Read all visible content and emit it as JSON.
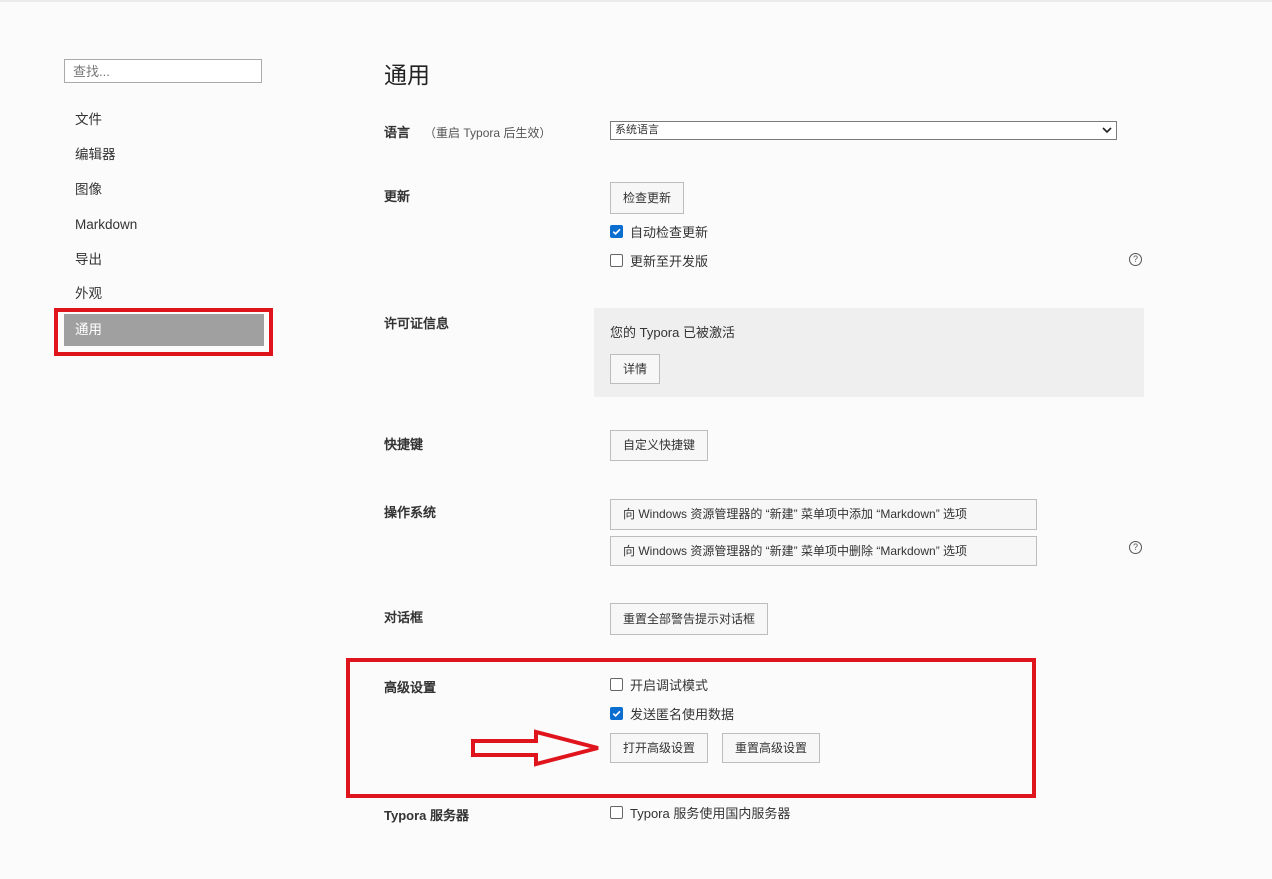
{
  "sidebar": {
    "search_placeholder": "查找...",
    "items": [
      {
        "label": "文件"
      },
      {
        "label": "编辑器"
      },
      {
        "label": "图像"
      },
      {
        "label": "Markdown"
      },
      {
        "label": "导出"
      },
      {
        "label": "外观"
      },
      {
        "label": "通用",
        "active": true
      }
    ]
  },
  "main": {
    "title": "通用",
    "language": {
      "label": "语言",
      "note": "（重启 Typora 后生效）",
      "selected": "系统语言"
    },
    "update": {
      "label": "更新",
      "check_button": "检查更新",
      "auto_check": {
        "label": "自动检查更新",
        "checked": true
      },
      "dev_channel": {
        "label": "更新至开发版",
        "checked": false
      }
    },
    "license": {
      "label": "许可证信息",
      "status": "您的 Typora 已被激活",
      "details_button": "详情"
    },
    "shortcuts": {
      "label": "快捷键",
      "button": "自定义快捷键"
    },
    "os": {
      "label": "操作系统",
      "add_button": "向 Windows 资源管理器的 “新建” 菜单项中添加 “Markdown” 选项",
      "remove_button": "向 Windows 资源管理器的 “新建” 菜单项中删除 “Markdown” 选项"
    },
    "dialogs": {
      "label": "对话框",
      "button": "重置全部警告提示对话框"
    },
    "advanced": {
      "label": "高级设置",
      "debug_mode": {
        "label": "开启调试模式",
        "checked": false
      },
      "send_usage": {
        "label": "发送匿名使用数据",
        "checked": true
      },
      "open_button": "打开高级设置",
      "reset_button": "重置高级设置"
    },
    "server": {
      "label": "Typora 服务器",
      "domestic": {
        "label": "Typora 服务使用国内服务器",
        "checked": false
      }
    }
  },
  "help_glyph": "?",
  "colors": {
    "annotation_red": "#e0141c",
    "checkbox_blue": "#0a6ed1",
    "active_nav_bg": "#a0a0a0"
  }
}
